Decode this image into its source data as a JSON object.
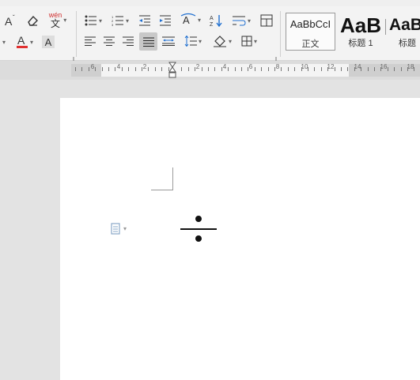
{
  "ribbon": {
    "phonetic_label": "wén",
    "font_color": "#e03030",
    "accent_color": "#1f6fd0",
    "styles": [
      {
        "sample": "AaBbCcI",
        "label": "正文"
      },
      {
        "sample": "AaB",
        "label": "标题 1"
      },
      {
        "sample": "AaB",
        "label": "标题"
      }
    ]
  },
  "ruler": {
    "labels": [
      "6",
      "4",
      "2",
      "2",
      "4",
      "6",
      "8",
      "10",
      "12",
      "14",
      "16",
      "18"
    ]
  }
}
